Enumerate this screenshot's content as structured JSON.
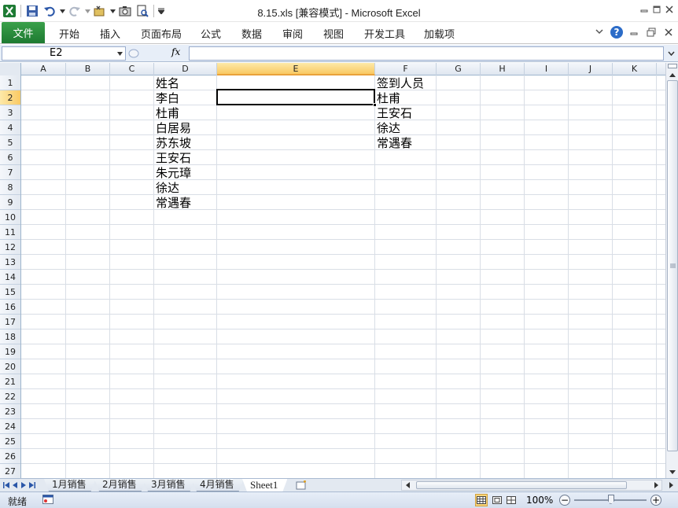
{
  "window": {
    "title": "8.15.xls  [兼容模式] - Microsoft Excel"
  },
  "ribbon": {
    "file_tab": "文件",
    "tabs": [
      "开始",
      "插入",
      "页面布局",
      "公式",
      "数据",
      "审阅",
      "视图",
      "开发工具",
      "加载项"
    ]
  },
  "formula_bar": {
    "name_box": "E2",
    "fx_label": "fx",
    "formula": ""
  },
  "grid": {
    "columns": [
      "A",
      "B",
      "C",
      "D",
      "E",
      "F",
      "G",
      "H",
      "I",
      "J",
      "K"
    ],
    "selected_column": "E",
    "rows": [
      "1",
      "2",
      "3",
      "4",
      "5",
      "6",
      "7",
      "8",
      "9",
      "10",
      "11",
      "12",
      "13",
      "14",
      "15",
      "16",
      "17",
      "18",
      "19",
      "20",
      "21",
      "22",
      "23",
      "24",
      "25",
      "26",
      "27"
    ],
    "selected_row": "2",
    "active_cell": "E2",
    "column_d": [
      "姓名",
      "李白",
      "杜甫",
      "白居易",
      "苏东坡",
      "王安石",
      "朱元璋",
      "徐达",
      "常遇春"
    ],
    "column_f": [
      "签到人员",
      "杜甫",
      "王安石",
      "徐达",
      "常遇春"
    ]
  },
  "sheet_tabs": {
    "items": [
      "1月销售",
      "2月销售",
      "3月销售",
      "4月销售",
      "Sheet1"
    ],
    "active": "Sheet1"
  },
  "status_bar": {
    "status": "就绪",
    "zoom": "100%",
    "zoom_level_percent": 100,
    "zoom_out": "−",
    "zoom_in": "+"
  },
  "colors": {
    "file_tab": "#1d7a31",
    "selected_header": "#f9c963",
    "help": "#2c6cc8"
  }
}
